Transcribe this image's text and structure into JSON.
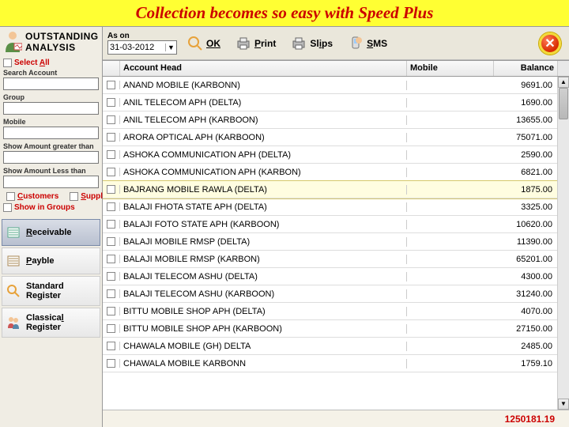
{
  "banner": {
    "title": "Collection becomes so easy with Speed Plus"
  },
  "sidebar": {
    "title1": "OUTSTANDING",
    "title2": "ANALYSIS",
    "select_all": "Select All",
    "search_account": "Search Account",
    "group": "Group",
    "mobile": "Mobile",
    "amt_gt": "Show Amount greater than",
    "amt_lt": "Show Amount Less than",
    "customers": "Customers",
    "suppliers": "Suppliers",
    "show_in_groups": "Show in Groups",
    "nav": {
      "receivable": "Receivable",
      "payable": "Payble",
      "standard": "Standard Register",
      "classical": "Classical Register"
    }
  },
  "toolbar": {
    "ason_label": "As on",
    "ason_value": "31-03-2012",
    "ok": "OK",
    "print": "Print",
    "slips": "Slips",
    "sms": "SMS"
  },
  "grid": {
    "head": {
      "account": "Account Head",
      "mobile": "Mobile",
      "balance": "Balance"
    },
    "rows": [
      {
        "name": "ANAND MOBILE (KARBONN)",
        "balance": "9691.00",
        "selected": false
      },
      {
        "name": "ANIL TELECOM APH (DELTA)",
        "balance": "1690.00",
        "selected": false
      },
      {
        "name": "ANIL TELECOM APH (KARBOON)",
        "balance": "13655.00",
        "selected": false
      },
      {
        "name": "ARORA OPTICAL APH (KARBOON)",
        "balance": "75071.00",
        "selected": false
      },
      {
        "name": "ASHOKA COMMUNICATION APH (DELTA)",
        "balance": "2590.00",
        "selected": false
      },
      {
        "name": "ASHOKA COMMUNICATION APH (KARBON)",
        "balance": "6821.00",
        "selected": false
      },
      {
        "name": "BAJRANG MOBILE RAWLA (DELTA)",
        "balance": "1875.00",
        "selected": true
      },
      {
        "name": "BALAJI FHOTA STATE APH (DELTA)",
        "balance": "3325.00",
        "selected": false
      },
      {
        "name": "BALAJI FOTO STATE APH (KARBOON)",
        "balance": "10620.00",
        "selected": false
      },
      {
        "name": "BALAJI MOBILE RMSP (DELTA)",
        "balance": "11390.00",
        "selected": false
      },
      {
        "name": "BALAJI MOBILE RMSP (KARBON)",
        "balance": "65201.00",
        "selected": false
      },
      {
        "name": "BALAJI TELECOM ASHU (DELTA)",
        "balance": "4300.00",
        "selected": false
      },
      {
        "name": "BALAJI TELECOM ASHU (KARBOON)",
        "balance": "31240.00",
        "selected": false
      },
      {
        "name": "BITTU MOBILE SHOP APH (DELTA)",
        "balance": "4070.00",
        "selected": false
      },
      {
        "name": "BITTU MOBILE SHOP APH (KARBOON)",
        "balance": "27150.00",
        "selected": false
      },
      {
        "name": "CHAWALA MOBILE (GH) DELTA",
        "balance": "2485.00",
        "selected": false
      },
      {
        "name": "CHAWALA MOBILE KARBONN",
        "balance": "1759.10",
        "selected": false
      }
    ],
    "total": "1250181.19"
  }
}
